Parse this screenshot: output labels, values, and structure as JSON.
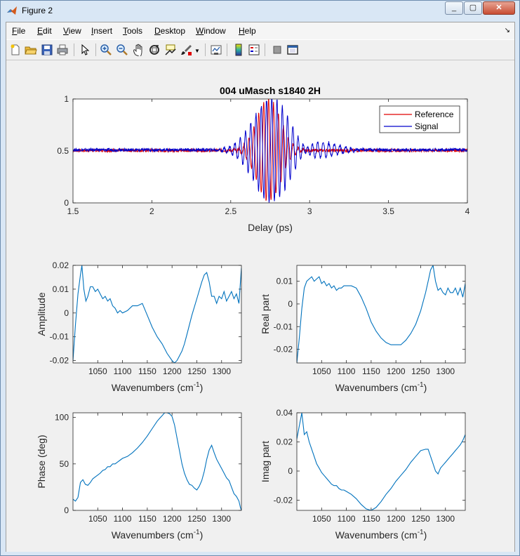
{
  "window": {
    "title": "Figure 2",
    "minimize": "_",
    "maximize": "▢",
    "close": "✕"
  },
  "menu": [
    {
      "label": "File",
      "u": "F",
      "rest": "ile"
    },
    {
      "label": "Edit",
      "u": "E",
      "rest": "dit"
    },
    {
      "label": "View",
      "u": "V",
      "rest": "iew"
    },
    {
      "label": "Insert",
      "u": "I",
      "rest": "nsert"
    },
    {
      "label": "Tools",
      "u": "T",
      "rest": "ools"
    },
    {
      "label": "Desktop",
      "u": "D",
      "rest": "esktop"
    },
    {
      "label": "Window",
      "u": "W",
      "rest": "indow"
    },
    {
      "label": "Help",
      "u": "H",
      "rest": "elp"
    }
  ],
  "toolbar": [
    "new-figure-icon",
    "open-file-icon",
    "save-icon",
    "print-icon",
    "pointer-icon",
    "zoom-in-icon",
    "zoom-out-icon",
    "pan-icon",
    "rotate-3d-icon",
    "data-cursor-icon",
    "brush-icon",
    "link-plot-icon",
    "colorbar-icon",
    "legend-icon",
    "hide-plot-tools-icon",
    "show-plot-tools-icon"
  ],
  "colors": {
    "reference": "#e00000",
    "signal": "#0000cc",
    "line": "#0072bd"
  },
  "chart_data": [
    {
      "type": "line",
      "title": "004 uMasch s1840 2H",
      "xlabel": "Delay (ps)",
      "ylabel": "",
      "xlim": [
        1.5,
        4
      ],
      "ylim": [
        0,
        1
      ],
      "xticks": [
        "1.5",
        "2",
        "2.5",
        "3",
        "3.5",
        "4"
      ],
      "yticks": [
        "0",
        "0.5",
        "1"
      ],
      "legend": {
        "placement": "top-right",
        "entries": [
          "Reference",
          "Signal"
        ]
      },
      "series": [
        {
          "name": "Reference",
          "model": {
            "center": 2.74,
            "sigma": 0.075,
            "freq": 32,
            "amp": 0.5,
            "base": 0.505
          }
        },
        {
          "name": "Signal",
          "model": {
            "center": 2.76,
            "sigma": 0.115,
            "freq": 30,
            "amp": 0.5,
            "base": 0.51
          }
        }
      ]
    },
    {
      "type": "line",
      "xlabel": "Wavenumbers (cm^-1)",
      "ylabel": "Amplitude",
      "xlim": [
        1000,
        1340
      ],
      "ylim": [
        -0.021,
        0.02
      ],
      "xticks": [
        "1050",
        "1100",
        "1150",
        "1200",
        "1250",
        "1300"
      ],
      "yticks": [
        "-0.02",
        "-0.01",
        "0",
        "0.01",
        "0.02"
      ],
      "x": [
        1000,
        1005,
        1010,
        1015,
        1018,
        1022,
        1026,
        1030,
        1035,
        1040,
        1045,
        1050,
        1055,
        1060,
        1065,
        1070,
        1075,
        1080,
        1085,
        1090,
        1095,
        1100,
        1110,
        1120,
        1130,
        1140,
        1150,
        1160,
        1170,
        1180,
        1190,
        1200,
        1205,
        1210,
        1215,
        1220,
        1225,
        1230,
        1240,
        1250,
        1260,
        1265,
        1270,
        1275,
        1280,
        1285,
        1290,
        1295,
        1300,
        1305,
        1310,
        1315,
        1320,
        1325,
        1330,
        1335,
        1340
      ],
      "y": [
        -0.02,
        -0.005,
        0.008,
        0.016,
        0.02,
        0.01,
        0.005,
        0.007,
        0.011,
        0.011,
        0.009,
        0.01,
        0.008,
        0.006,
        0.007,
        0.005,
        0.006,
        0.003,
        0.002,
        0.0,
        0.001,
        0.0,
        0.001,
        0.003,
        0.003,
        0.004,
        -0.001,
        -0.006,
        -0.01,
        -0.013,
        -0.017,
        -0.02,
        -0.021,
        -0.02,
        -0.018,
        -0.016,
        -0.013,
        -0.009,
        -0.001,
        0.006,
        0.013,
        0.016,
        0.017,
        0.013,
        0.007,
        0.007,
        0.004,
        0.007,
        0.006,
        0.009,
        0.005,
        0.007,
        0.009,
        0.006,
        0.008,
        0.004,
        0.019
      ]
    },
    {
      "type": "line",
      "xlabel": "Wavenumbers (cm^-1)",
      "ylabel": "Real part",
      "xlim": [
        1000,
        1340
      ],
      "ylim": [
        -0.026,
        0.017
      ],
      "xticks": [
        "1050",
        "1100",
        "1150",
        "1200",
        "1250",
        "1300"
      ],
      "yticks": [
        "-0.02",
        "-0.01",
        "0",
        "0.01"
      ],
      "x": [
        1000,
        1005,
        1010,
        1015,
        1020,
        1025,
        1030,
        1035,
        1040,
        1045,
        1050,
        1055,
        1060,
        1065,
        1070,
        1075,
        1080,
        1085,
        1090,
        1095,
        1100,
        1110,
        1120,
        1130,
        1140,
        1150,
        1160,
        1170,
        1180,
        1190,
        1200,
        1210,
        1220,
        1230,
        1240,
        1250,
        1260,
        1265,
        1270,
        1275,
        1280,
        1285,
        1290,
        1295,
        1300,
        1305,
        1310,
        1315,
        1320,
        1325,
        1330,
        1335,
        1340
      ],
      "y": [
        -0.026,
        -0.015,
        -0.002,
        0.007,
        0.01,
        0.011,
        0.012,
        0.01,
        0.011,
        0.012,
        0.009,
        0.01,
        0.008,
        0.009,
        0.007,
        0.008,
        0.006,
        0.007,
        0.007,
        0.008,
        0.008,
        0.008,
        0.007,
        0.003,
        -0.002,
        -0.008,
        -0.012,
        -0.015,
        -0.017,
        -0.018,
        -0.018,
        -0.018,
        -0.016,
        -0.013,
        -0.009,
        -0.003,
        0.005,
        0.01,
        0.015,
        0.017,
        0.01,
        0.006,
        0.007,
        0.005,
        0.004,
        0.007,
        0.005,
        0.005,
        0.007,
        0.004,
        0.007,
        0.003,
        0.009
      ]
    },
    {
      "type": "line",
      "xlabel": "Wavenumbers (cm^-1)",
      "ylabel": "Phase (deg)",
      "xlim": [
        1000,
        1340
      ],
      "ylim": [
        0,
        105
      ],
      "xticks": [
        "1050",
        "1100",
        "1150",
        "1200",
        "1250",
        "1300"
      ],
      "yticks": [
        "0",
        "50",
        "100"
      ],
      "x": [
        1000,
        1005,
        1010,
        1015,
        1020,
        1025,
        1030,
        1035,
        1040,
        1045,
        1050,
        1055,
        1060,
        1065,
        1070,
        1075,
        1080,
        1085,
        1090,
        1095,
        1100,
        1110,
        1120,
        1130,
        1140,
        1150,
        1160,
        1170,
        1175,
        1180,
        1185,
        1190,
        1195,
        1200,
        1205,
        1210,
        1215,
        1220,
        1225,
        1230,
        1235,
        1240,
        1245,
        1250,
        1255,
        1260,
        1265,
        1270,
        1275,
        1280,
        1285,
        1290,
        1295,
        1300,
        1305,
        1310,
        1315,
        1320,
        1325,
        1330,
        1335,
        1338,
        1340
      ],
      "y": [
        12,
        10,
        14,
        30,
        33,
        28,
        27,
        30,
        34,
        36,
        38,
        40,
        43,
        44,
        47,
        47,
        50,
        50,
        52,
        54,
        56,
        58,
        62,
        67,
        73,
        80,
        88,
        96,
        99,
        102,
        105,
        105,
        104,
        101,
        92,
        78,
        64,
        50,
        40,
        33,
        28,
        27,
        24,
        22,
        26,
        32,
        42,
        55,
        65,
        70,
        62,
        55,
        50,
        45,
        40,
        35,
        32,
        25,
        18,
        15,
        10,
        3,
        0
      ]
    },
    {
      "type": "line",
      "xlabel": "Wavenumbers (cm^-1)",
      "ylabel": "Imag part",
      "xlim": [
        1000,
        1340
      ],
      "ylim": [
        -0.027,
        0.04
      ],
      "xticks": [
        "1050",
        "1100",
        "1150",
        "1200",
        "1250",
        "1300"
      ],
      "yticks": [
        "-0.02",
        "0",
        "0.02",
        "0.04"
      ],
      "x": [
        1000,
        1005,
        1010,
        1015,
        1020,
        1025,
        1030,
        1035,
        1040,
        1045,
        1050,
        1055,
        1060,
        1065,
        1070,
        1075,
        1080,
        1085,
        1090,
        1095,
        1100,
        1110,
        1120,
        1130,
        1140,
        1150,
        1160,
        1170,
        1180,
        1190,
        1200,
        1210,
        1220,
        1230,
        1240,
        1250,
        1260,
        1265,
        1270,
        1275,
        1280,
        1285,
        1290,
        1295,
        1300,
        1305,
        1310,
        1315,
        1320,
        1325,
        1330,
        1335,
        1340
      ],
      "y": [
        0.022,
        0.031,
        0.04,
        0.025,
        0.027,
        0.02,
        0.015,
        0.01,
        0.005,
        0.002,
        -0.001,
        -0.003,
        -0.005,
        -0.007,
        -0.009,
        -0.01,
        -0.01,
        -0.012,
        -0.013,
        -0.013,
        -0.014,
        -0.016,
        -0.019,
        -0.023,
        -0.026,
        -0.027,
        -0.025,
        -0.021,
        -0.016,
        -0.012,
        -0.007,
        -0.003,
        0.001,
        0.006,
        0.01,
        0.014,
        0.015,
        0.015,
        0.01,
        0.005,
        0.0,
        -0.002,
        0.002,
        0.004,
        0.006,
        0.008,
        0.01,
        0.012,
        0.014,
        0.016,
        0.018,
        0.021,
        0.025
      ]
    }
  ]
}
